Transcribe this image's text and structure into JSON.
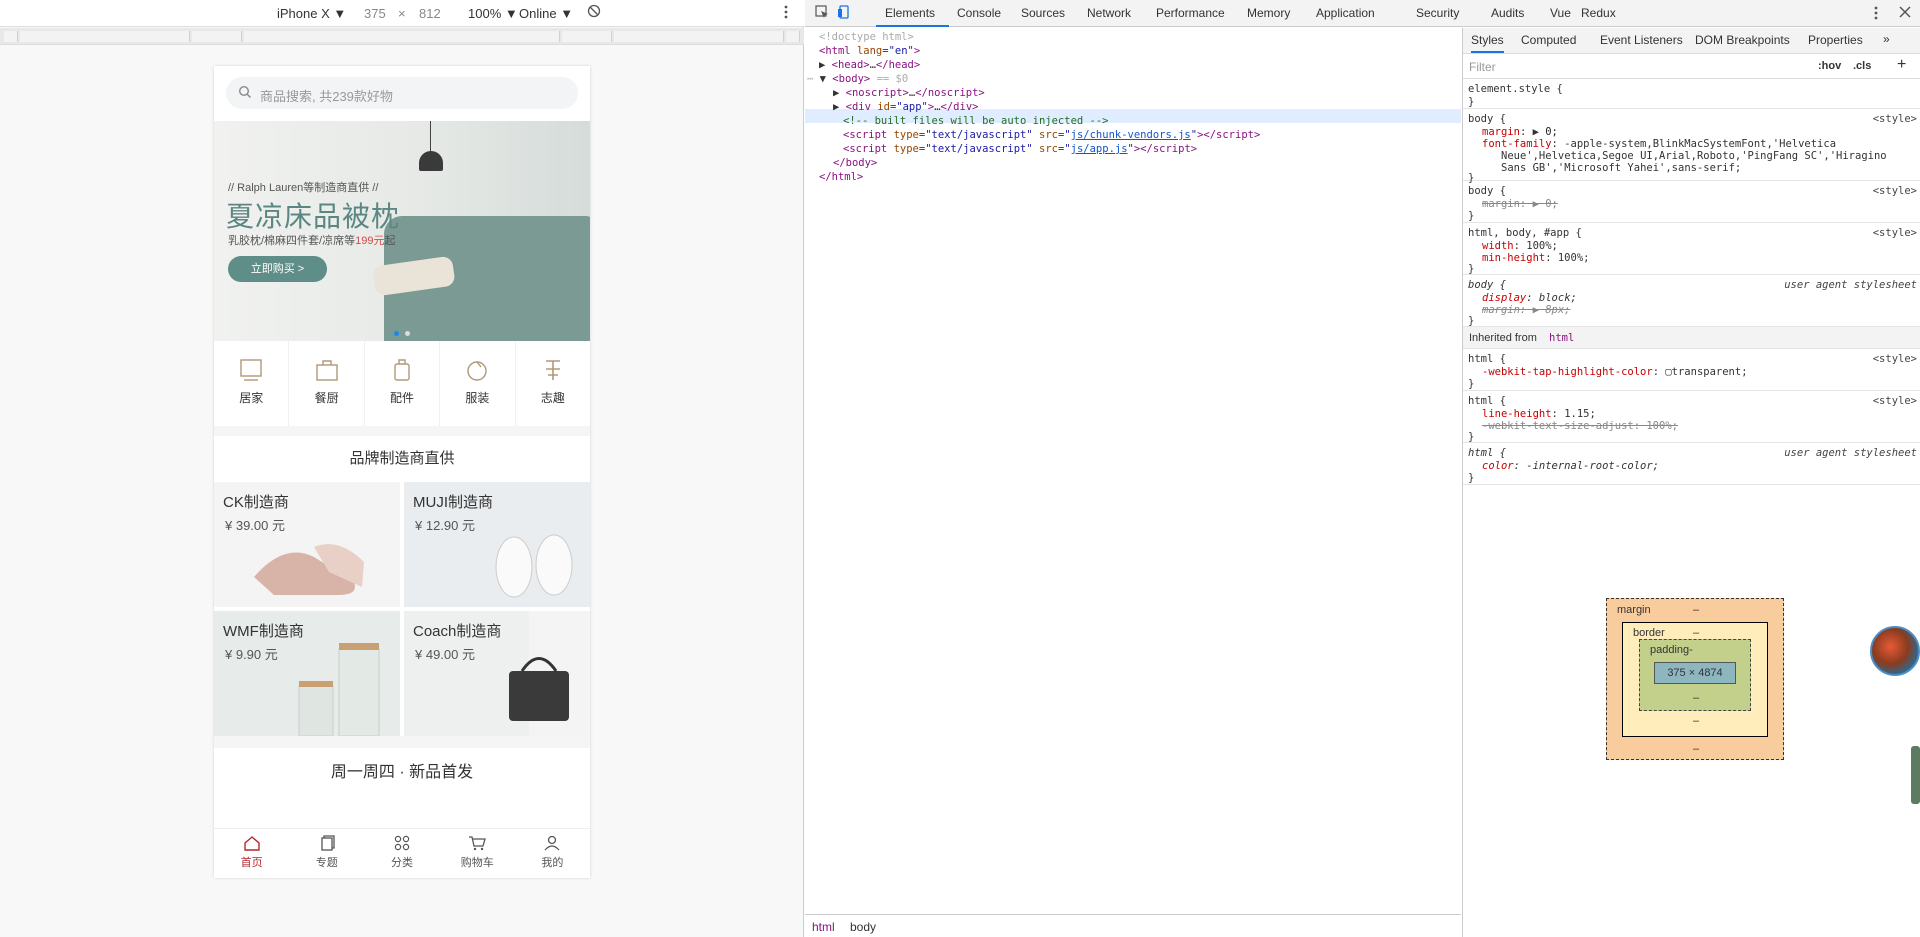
{
  "device_toolbar": {
    "device": "iPhone X ▼",
    "width": "375",
    "times": "×",
    "height": "812",
    "zoom": "100% ▼",
    "network": "Online ▼"
  },
  "phone": {
    "search_placeholder": "商品搜索, 共239款好物",
    "banner": {
      "sub": "// Ralph Lauren等制造商直供 //",
      "title": "夏凉床品被枕",
      "desc_pre": "乳胶枕/棉麻四件套/凉席等",
      "desc_price": "199元",
      "desc_post": "起",
      "button": "立即购买 >"
    },
    "categories": [
      "居家",
      "餐厨",
      "配件",
      "服装",
      "志趣"
    ],
    "brand_section_title": "品牌制造商直供",
    "brands": [
      {
        "name": "CK制造商",
        "price": "¥ 39.00 元"
      },
      {
        "name": "MUJI制造商",
        "price": "¥ 12.90 元"
      },
      {
        "name": "WMF制造商",
        "price": "¥ 9.90 元"
      },
      {
        "name": "Coach制造商",
        "price": "¥ 49.00 元"
      }
    ],
    "new_section_title": "周一周四 · 新品首发",
    "tabbar": [
      "首页",
      "专题",
      "分类",
      "购物车",
      "我的"
    ]
  },
  "devtools": {
    "tabs": [
      "Elements",
      "Console",
      "Sources",
      "Network",
      "Performance",
      "Memory",
      "Application",
      "Security",
      "Audits",
      "Vue",
      "Redux"
    ],
    "breadcrumbs": [
      "html",
      "body"
    ],
    "style_tabs": [
      "Styles",
      "Computed",
      "Event Listeners",
      "DOM Breakpoints",
      "Properties"
    ],
    "filter_placeholder": "Filter",
    "hov": ":hov",
    "cls": ".cls",
    "inherited_label": "Inherited from",
    "inherited_tag": "html",
    "box_model": {
      "margin": "margin",
      "border": "border",
      "padding": "padding-",
      "content": "375 × 4874",
      "dash": "–"
    }
  }
}
